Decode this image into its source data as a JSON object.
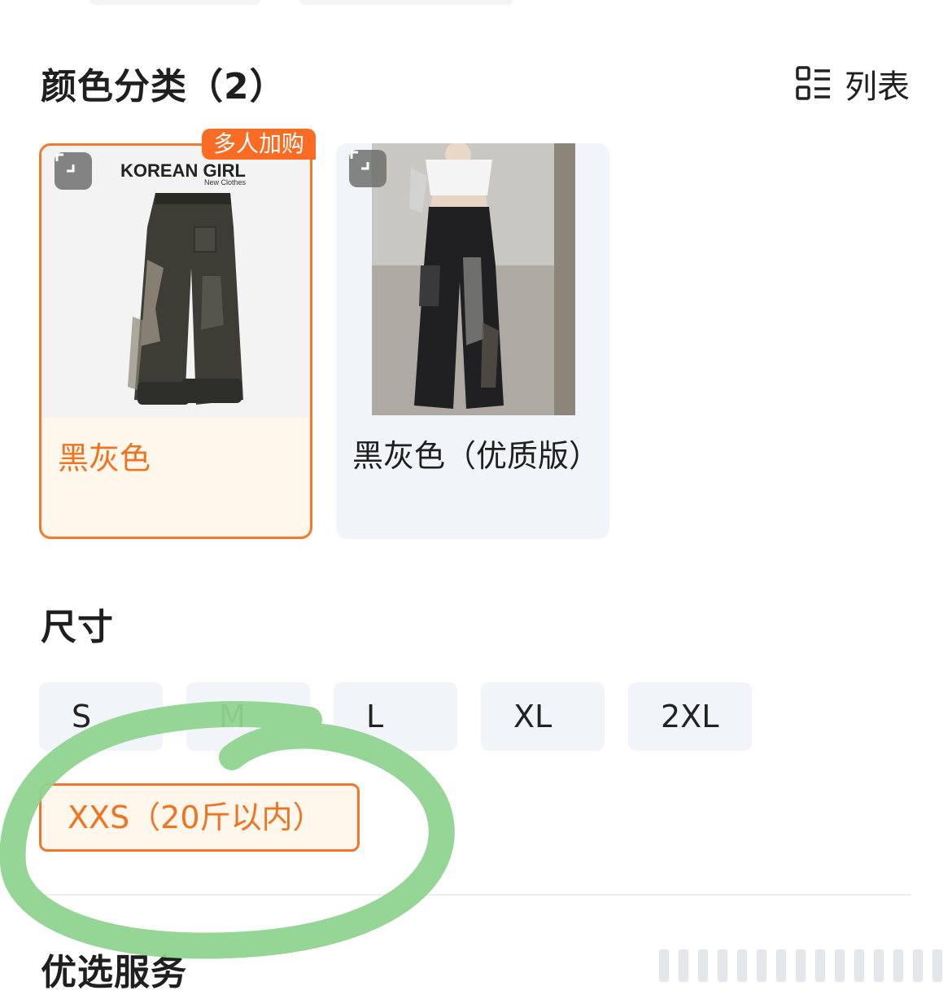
{
  "color_section": {
    "title": "颜色分类（2）",
    "view_toggle_label": "列表",
    "view_toggle_icon": "list-view-icon",
    "options": [
      {
        "label": "黑灰色",
        "selected": true,
        "badge": "多人加购",
        "image_brand": "KOREAN GIRL",
        "image_tagline": "New Clothes",
        "image_icon": "expand-icon"
      },
      {
        "label": "黑灰色（优质版）",
        "selected": false,
        "image_icon": "expand-icon"
      }
    ]
  },
  "size_section": {
    "title": "尺寸",
    "options": [
      "S",
      "M",
      "L",
      "XL",
      "2XL"
    ],
    "selected_option": "XXS（20斤以内）"
  },
  "services_section": {
    "title": "优选服务"
  },
  "colors": {
    "accent_orange": "#f47a2a",
    "badge_orange": "#fa6c23",
    "chip_bg": "#f1f5f9",
    "selected_bg": "#fff6ec",
    "annotation_green": "#8fd38f"
  }
}
